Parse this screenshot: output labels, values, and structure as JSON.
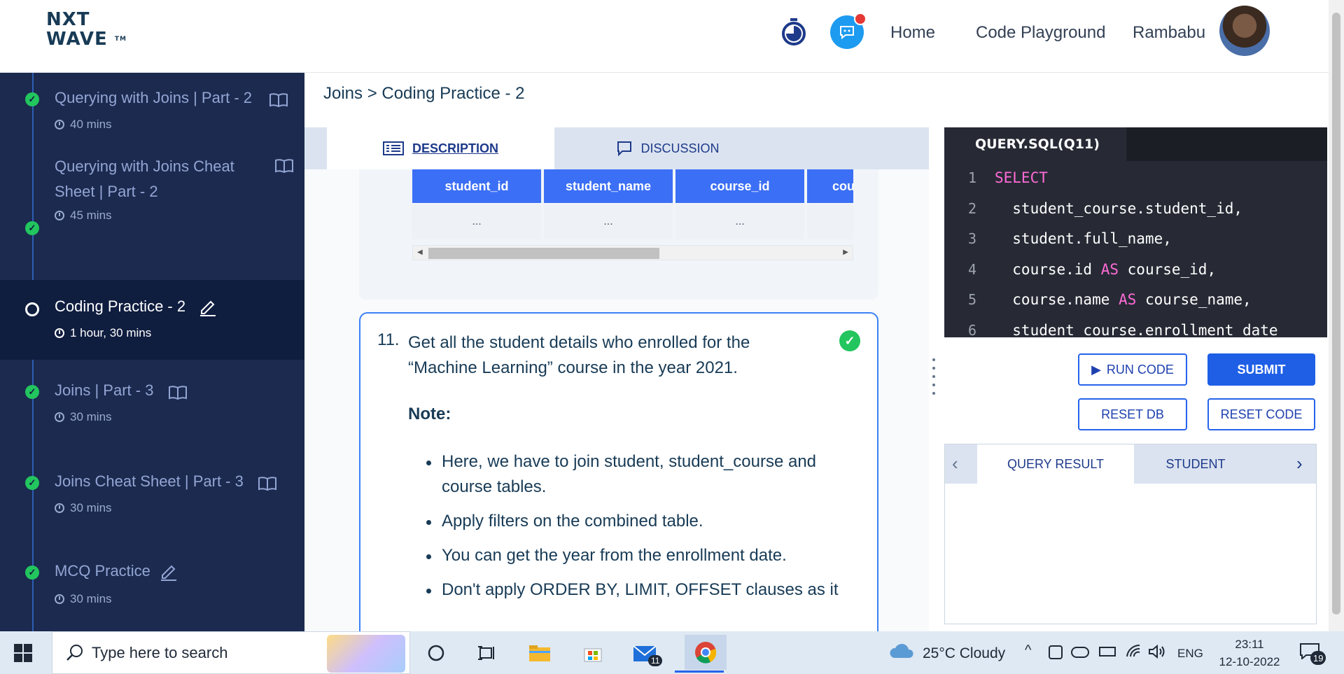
{
  "header": {
    "logo_line1": "NXT",
    "logo_line2": "WAVE",
    "logo_tm": "TM",
    "nav_home": "Home",
    "nav_playground": "Code Playground",
    "user_name": "Rambabu"
  },
  "sidebar": {
    "items": [
      {
        "title": "Querying with Joins | Part - 2",
        "time": "40 mins",
        "status": "completed",
        "icon": "book-icon"
      },
      {
        "title": "Querying with Joins Cheat Sheet | Part - 2",
        "time": "45 mins",
        "status": "completed",
        "icon": "book-icon"
      },
      {
        "title": "Coding Practice - 2",
        "time": "1 hour, 30 mins",
        "status": "current",
        "icon": "pencil-icon"
      },
      {
        "title": "Joins | Part - 3",
        "time": "30 mins",
        "status": "completed",
        "icon": "book-icon"
      },
      {
        "title": "Joins Cheat Sheet | Part - 3",
        "time": "30 mins",
        "status": "completed",
        "icon": "book-icon"
      },
      {
        "title": "MCQ Practice",
        "time": "30 mins",
        "status": "completed",
        "icon": "pencil-icon"
      }
    ]
  },
  "breadcrumb": "Joins > Coding Practice - 2",
  "desc_tabs": {
    "description": "DESCRIPTION",
    "discussion": "DISCUSSION"
  },
  "example_table": {
    "headers": [
      "student_id",
      "student_name",
      "course_id",
      "cour"
    ],
    "row": [
      "...",
      "...",
      "...",
      ""
    ]
  },
  "question": {
    "number": "11.",
    "text": "Get all the student details who enrolled for the “Machine Learning” course in the year 2021.",
    "note_label": "Note:",
    "notes": [
      "Here, we have to join student, student_course and course tables.",
      "Apply filters on the combined table.",
      "You can get the year from the enrollment date.",
      "Don't apply ORDER BY, LIMIT, OFFSET clauses as it"
    ]
  },
  "editor": {
    "tab_label": "QUERY.SQL(Q11)",
    "lines": [
      {
        "n": "1",
        "code": "SELECT",
        "kw": ""
      },
      {
        "n": "2",
        "code": "  student_course.student_id,",
        "kw": ""
      },
      {
        "n": "3",
        "code": "  student.full_name,",
        "kw": ""
      },
      {
        "n": "4",
        "code": "  course.id ",
        "kw": "AS",
        "rest": " course_id,"
      },
      {
        "n": "5",
        "code": "  course.name ",
        "kw": "AS",
        "rest": " course_name,"
      },
      {
        "n": "6",
        "code": "  student_course.enrollment_date",
        "kw": ""
      }
    ]
  },
  "buttons": {
    "run": "RUN CODE",
    "submit": "SUBMIT",
    "reset_db": "RESET DB",
    "reset_code": "RESET CODE"
  },
  "results": {
    "tab_active": "QUERY RESULT",
    "tab_other": "STUDENT"
  },
  "taskbar": {
    "search_placeholder": "Type here to search",
    "weather": "25°C  Cloudy",
    "language": "ENG",
    "time": "23:11",
    "date": "12-10-2022",
    "mail_badge": "11",
    "notif_badge": "19"
  },
  "colors": {
    "sidebar_bg": "#1b2a4e",
    "accent_blue": "#1e5fe6",
    "success_green": "#22c55e",
    "editor_bg": "#272a35",
    "keyword_pink": "#ff6bd6"
  }
}
